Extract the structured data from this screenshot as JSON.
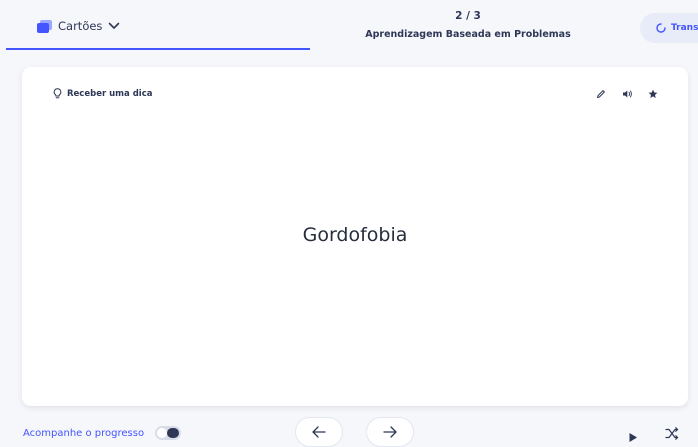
{
  "header": {
    "mode_label": "Cartões",
    "counter": "2 / 3",
    "deck_title": "Aprendizagem Baseada em Problemas",
    "transform_label": "Transf"
  },
  "card": {
    "hint_label": "Receber uma dica",
    "term": "Gordofobia",
    "actions": [
      "pencil-icon",
      "speaker-icon",
      "star-icon"
    ]
  },
  "footer": {
    "progress_label": "Acompanhe o progresso",
    "progress_tracking_on": false
  },
  "colors": {
    "accent": "#4255ff",
    "text": "#282e3e",
    "background": "#f6f7fb",
    "card": "#ffffff"
  }
}
